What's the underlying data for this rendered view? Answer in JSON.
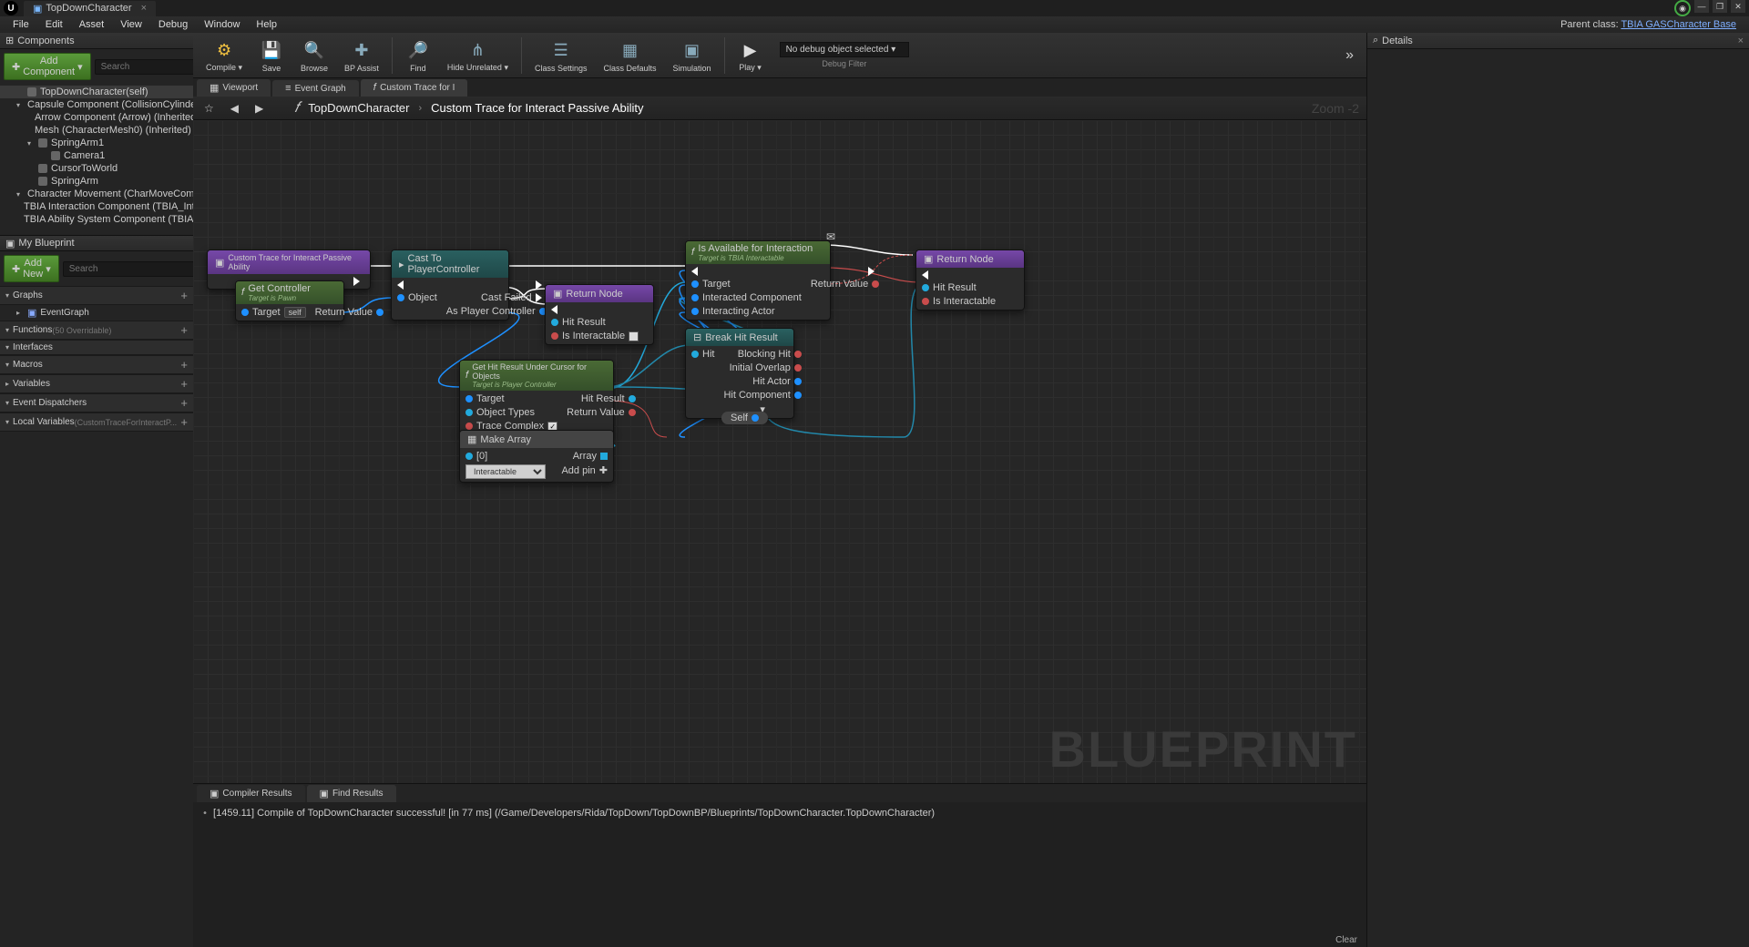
{
  "title_tab": "TopDownCharacter",
  "menu": [
    "File",
    "Edit",
    "Asset",
    "View",
    "Debug",
    "Window",
    "Help"
  ],
  "parent_class_label": "Parent class:",
  "parent_class_value": "TBIA GASCharacter Base",
  "panels": {
    "components": "Components",
    "details": "Details",
    "myblueprint": "My Blueprint"
  },
  "buttons": {
    "add_component": "Add Component",
    "add_new": "Add New"
  },
  "search_placeholder": "Search",
  "components_tree": [
    {
      "d": 0,
      "label": "TopDownCharacter(self)",
      "sel": true
    },
    {
      "d": 0,
      "label": "Capsule Component (CollisionCylinder) (",
      "tri": "▾"
    },
    {
      "d": 1,
      "label": "Arrow Component (Arrow) (Inherited)"
    },
    {
      "d": 1,
      "label": "Mesh (CharacterMesh0) (Inherited)"
    },
    {
      "d": 1,
      "label": "SpringArm1",
      "tri": "▾"
    },
    {
      "d": 2,
      "label": "Camera1"
    },
    {
      "d": 1,
      "label": "CursorToWorld"
    },
    {
      "d": 1,
      "label": "SpringArm"
    },
    {
      "d": 0,
      "label": "Character Movement (CharMoveComp) (I",
      "tri": "▾"
    },
    {
      "d": 0,
      "label": "TBIA Interaction Component (TBIA_Intera"
    },
    {
      "d": 0,
      "label": "TBIA Ability System Component (TBIA_Ab"
    }
  ],
  "blueprint_cats": [
    {
      "label": "Graphs",
      "plus": true,
      "sub": [
        {
          "label": "EventGraph",
          "tri": "▸"
        }
      ]
    },
    {
      "label": "Functions",
      "suffix": "(50 Overridable)",
      "plus": true
    },
    {
      "label": "Interfaces"
    },
    {
      "label": "Macros",
      "plus": true
    },
    {
      "label": "Variables",
      "plus": true,
      "tri": "▸"
    },
    {
      "label": "Event Dispatchers",
      "plus": true
    },
    {
      "label": "Local Variables",
      "suffix": "(CustomTraceForInteractP...",
      "plus": true
    }
  ],
  "toolbar": [
    {
      "icon": "⚙",
      "label": "Compile",
      "col": "#f0c040",
      "drop": true
    },
    {
      "icon": "💾",
      "label": "Save",
      "col": "#8ab"
    },
    {
      "icon": "🔍",
      "label": "Browse",
      "col": "#8ab"
    },
    {
      "icon": "✚",
      "label": "BP Assist",
      "col": "#8ab"
    },
    {
      "sep": true
    },
    {
      "icon": "🔎",
      "label": "Find",
      "col": "#8ab"
    },
    {
      "icon": "⋔",
      "label": "Hide Unrelated",
      "col": "#8ab",
      "drop": true
    },
    {
      "sep": true
    },
    {
      "icon": "☰",
      "label": "Class Settings",
      "col": "#8ab"
    },
    {
      "icon": "▦",
      "label": "Class Defaults",
      "col": "#8ab"
    },
    {
      "icon": "▣",
      "label": "Simulation",
      "col": "#8ab"
    },
    {
      "sep": true
    },
    {
      "icon": "▶",
      "label": "Play",
      "col": "#ddd",
      "drop": true
    }
  ],
  "debug_selected": "No debug object selected",
  "debug_filter": "Debug Filter",
  "editor_tabs": [
    {
      "label": "Viewport",
      "icon": "▦"
    },
    {
      "label": "Event Graph",
      "icon": "≡"
    },
    {
      "label": "Custom Trace for I",
      "icon": "𝑓",
      "active": true
    }
  ],
  "breadcrumb": {
    "root": "TopDownCharacter",
    "current": "Custom Trace for Interact Passive Ability",
    "zoom": "Zoom -2"
  },
  "watermark": "BLUEPRINT",
  "nodes": {
    "entry": {
      "title": "Custom Trace for Interact Passive Ability"
    },
    "getcontroller": {
      "title": "Get Controller",
      "sub": "Target is Pawn",
      "target": "Target",
      "selfchip": "self",
      "rv": "Return Value"
    },
    "cast": {
      "title": "Cast To PlayerController",
      "obj": "Object",
      "fail": "Cast Failed",
      "aspc": "As Player Controller"
    },
    "return1": {
      "title": "Return Node",
      "hr": "Hit Result",
      "ii": "Is Interactable"
    },
    "gethit": {
      "title": "Get Hit Result Under Cursor for Objects",
      "sub": "Target is Player Controller",
      "target": "Target",
      "ot": "Object Types",
      "tc": "Trace Complex",
      "hr": "Hit Result",
      "rv": "Return Value"
    },
    "makearray": {
      "title": "Make Array",
      "idx": "[0]",
      "val": "Interactable",
      "arr": "Array",
      "addpin": "Add pin"
    },
    "isavail": {
      "title": "Is Available for Interaction",
      "sub": "Target is TBIA Interactable",
      "target": "Target",
      "ic": "Interacted Component",
      "ia": "Interacting Actor",
      "rv": "Return Value"
    },
    "breakhit": {
      "title": "Break Hit Result",
      "hit": "Hit",
      "bh": "Blocking Hit",
      "io": "Initial Overlap",
      "ha": "Hit Actor",
      "hc": "Hit Component"
    },
    "selfnode": {
      "label": "Self"
    },
    "return2": {
      "title": "Return Node",
      "hr": "Hit Result",
      "ii": "Is Interactable"
    }
  },
  "results_tabs": [
    {
      "label": "Compiler Results",
      "active": true
    },
    {
      "label": "Find Results"
    }
  ],
  "compile_msg": "[1459.11] Compile of TopDownCharacter successful! [in 77 ms] (/Game/Developers/Rida/TopDown/TopDownBP/Blueprints/TopDownCharacter.TopDownCharacter)",
  "clear": "Clear"
}
